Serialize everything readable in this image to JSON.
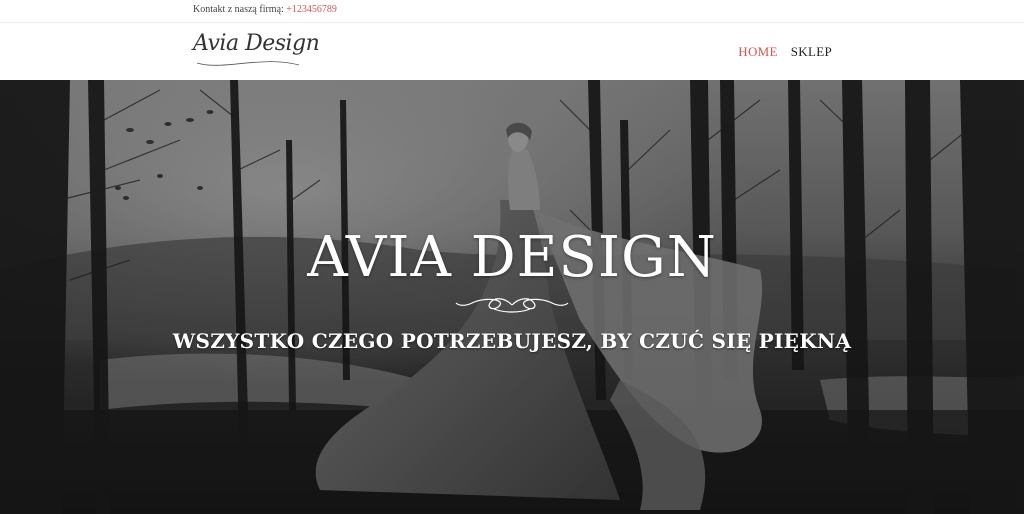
{
  "topbar": {
    "contact_label": "Kontakt z naszą firmą:",
    "phone": "+123456789"
  },
  "header": {
    "logo_text": "Avia Design",
    "nav": [
      {
        "label": "HOME",
        "active": true
      },
      {
        "label": "SKLEP",
        "active": false
      }
    ]
  },
  "hero": {
    "title": "AVIA DESIGN",
    "subtitle": "WSZYSTKO CZEGO POTRZEBUJESZ, BY CZUĆ SIĘ PIĘKNĄ"
  },
  "colors": {
    "accent": "#d9534f",
    "text_dark": "#222222",
    "hero_text": "#ffffff"
  }
}
